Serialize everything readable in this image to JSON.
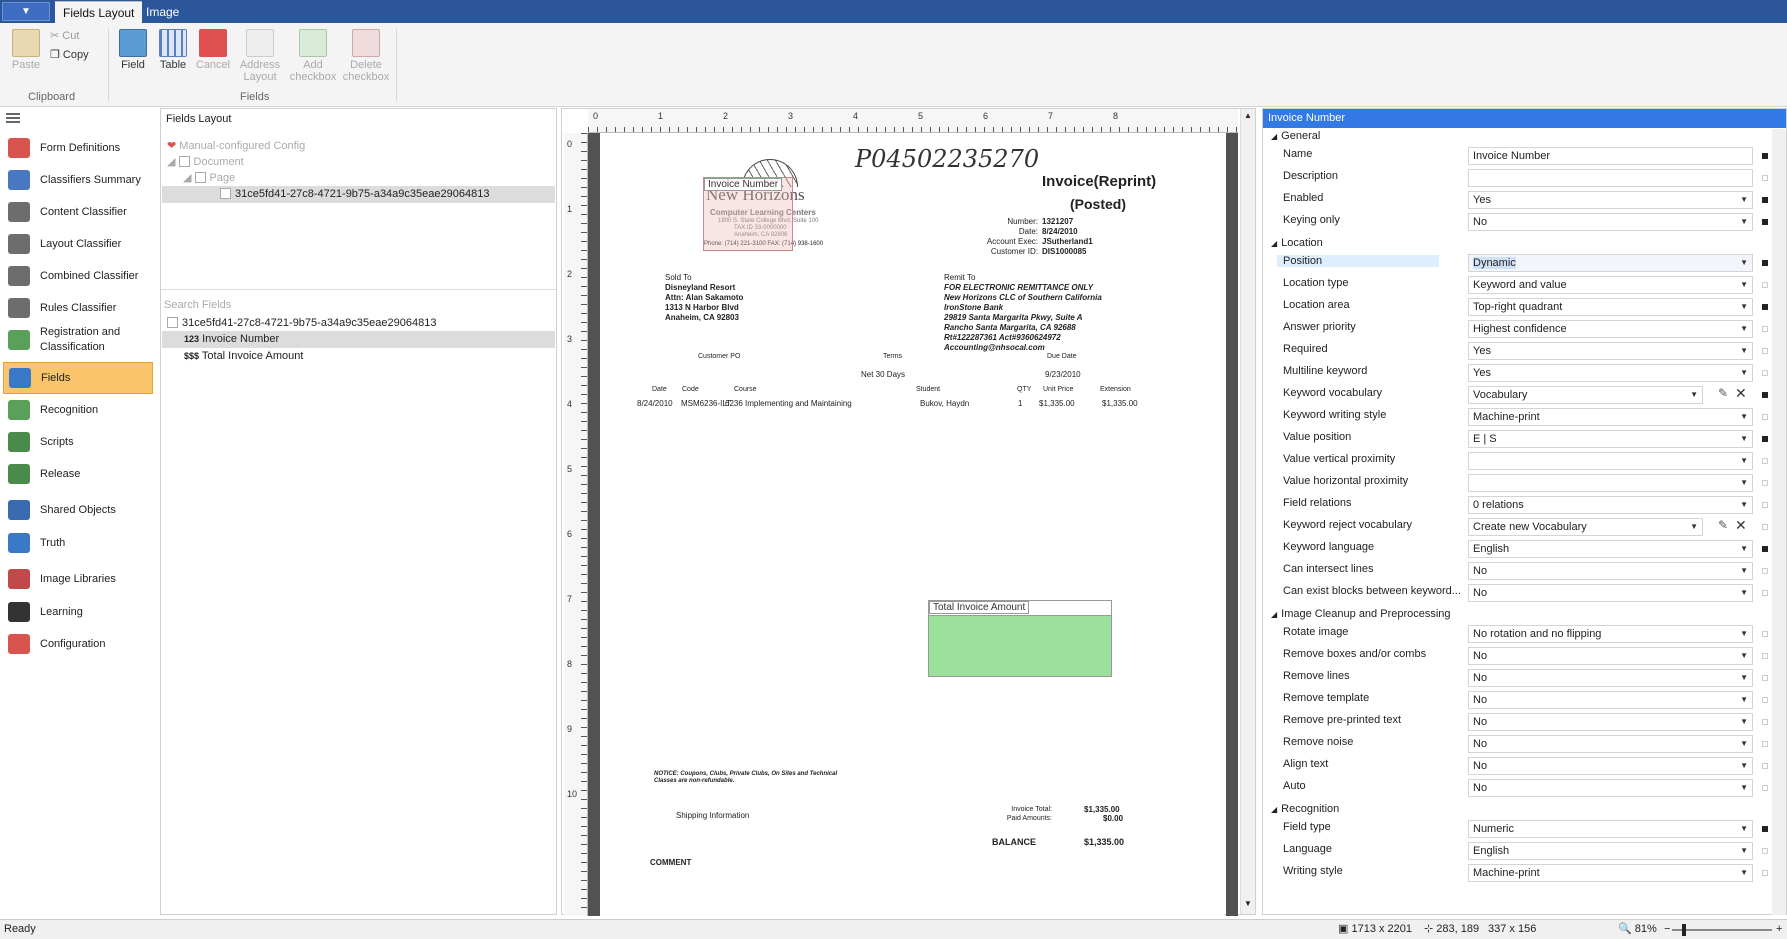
{
  "app": {
    "menu_button": "▼",
    "tabs": [
      "Fields Layout",
      "Image"
    ]
  },
  "ribbon": {
    "clipboard": {
      "paste": "Paste",
      "cut": "Cut",
      "copy": "Copy",
      "group": "Clipboard"
    },
    "fields": {
      "field": "Field",
      "table": "Table",
      "cancel": "Cancel",
      "address_layout": "Address Layout",
      "add_checkbox": "Add checkbox",
      "delete_checkbox": "Delete checkbox",
      "group": "Fields"
    }
  },
  "nav": {
    "items": [
      {
        "label": "Form Definitions",
        "icon": "form-definitions-icon",
        "color": "#d9534f"
      },
      {
        "label": "Classifiers Summary",
        "icon": "classifiers-summary-icon",
        "color": "#4a78c0"
      },
      {
        "label": "Content Classifier",
        "icon": "content-classifier-icon",
        "color": "#6d6d6d"
      },
      {
        "label": "Layout Classifier",
        "icon": "layout-classifier-icon",
        "color": "#6d6d6d"
      },
      {
        "label": "Combined Classifier",
        "icon": "combined-classifier-icon",
        "color": "#6d6d6d"
      },
      {
        "label": "Rules Classifier",
        "icon": "rules-classifier-icon",
        "color": "#6d6d6d"
      },
      {
        "label": "Registration and Classification",
        "icon": "registration-icon",
        "color": "#5aa05a"
      },
      {
        "label": "Fields",
        "icon": "fields-icon",
        "color": "#3a78c8",
        "active": true
      },
      {
        "label": "Recognition",
        "icon": "recognition-icon",
        "color": "#5aa05a"
      },
      {
        "label": "Scripts",
        "icon": "scripts-icon",
        "color": "#4a8a4a"
      },
      {
        "label": "Release",
        "icon": "release-icon",
        "color": "#4a8a4a"
      },
      {
        "label": "Shared Objects",
        "icon": "shared-objects-icon",
        "color": "#3a6ab0"
      },
      {
        "label": "Truth",
        "icon": "truth-icon",
        "color": "#3a78c8"
      },
      {
        "label": "Image Libraries",
        "icon": "image-libraries-icon",
        "color": "#c04a4a"
      },
      {
        "label": "Learning",
        "icon": "learning-icon",
        "color": "#333333"
      },
      {
        "label": "Configuration",
        "icon": "configuration-icon",
        "color": "#d9534f"
      }
    ]
  },
  "fields_panel": {
    "title": "Fields Layout",
    "tree": {
      "config": "Manual-configured Config",
      "document": "Document",
      "page": "Page",
      "guid": "31ce5fd41-27c8-4721-9b75-a34a9c35eae29064813"
    },
    "search_label": "Search Fields",
    "list_guid": "31ce5fd41-27c8-4721-9b75-a34a9c35eae29064813",
    "fields": [
      {
        "prefix": "123",
        "name": "Invoice Number"
      },
      {
        "prefix": "$$$",
        "name": "Total Invoice Amount"
      }
    ]
  },
  "ruler": {
    "h": [
      "0",
      "1",
      "2",
      "3",
      "4",
      "5",
      "6",
      "7",
      "8"
    ],
    "v": [
      "0",
      "1",
      "2",
      "3",
      "4",
      "5",
      "6",
      "7",
      "8",
      "9",
      "10"
    ]
  },
  "document": {
    "handwritten": "P04502235270",
    "title": "Invoice(Reprint)",
    "subtitle": "(Posted)",
    "logo": {
      "name": "New Horizons",
      "tagline": "Computer Learning Centers",
      "addr1": "1900 S. State College Blvd, Suite 100",
      "addr2": "TAX ID 33-0000000",
      "addr3": "Anaheim, CA 92806",
      "phone": "Phone: (714) 221-3100   FAX: (714) 938-1600"
    },
    "meta": [
      [
        "Number:",
        "1321207"
      ],
      [
        "Date:",
        "8/24/2010"
      ],
      [
        "Account Exec:",
        "JSutherland1"
      ],
      [
        "Customer ID:",
        "DIS1000085"
      ]
    ],
    "sold_to": [
      "Sold To",
      "Disneyland Resort",
      "Attn: Alan Sakamoto",
      "1313 N Harbor Blvd",
      "Anaheim, CA  92803"
    ],
    "remit_to": [
      "Remit To",
      "FOR ELECTRONIC REMITTANCE ONLY",
      "New Horizons CLC of Southern California",
      "IronStone Bank",
      "29819 Santa Margarita Pkwy, Suite A",
      "Rancho Santa Margarita, CA 92688",
      "Rt#122287361 Act#9360624972",
      "Accounting@nhsocal.com"
    ],
    "terms_headers": [
      "Customer PO",
      "Terms",
      "Due Date"
    ],
    "terms_values": [
      "",
      "Net 30 Days",
      "9/23/2010"
    ],
    "line_headers": [
      "Date",
      "Code",
      "Course",
      "Student",
      "QTY",
      "Unit Price",
      "Extension"
    ],
    "line_item": [
      "8/24/2010",
      "MSM6236-ILT",
      "6236 Implementing and Maintaining",
      "Bukov, Haydn",
      "1",
      "$1,335.00",
      "$1,335.00"
    ],
    "notice": "NOTICE:  Coupons, Clubs, Private Clubs, On Sites and Technical Classes are non-refundable.",
    "shipping": "Shipping Information",
    "totals": [
      [
        "Invoice Total:",
        "$1,335.00"
      ],
      [
        "Paid Amounts:",
        "$0.00"
      ]
    ],
    "balance_label": "BALANCE",
    "balance_value": "$1,335.00",
    "comment": "COMMENT",
    "zone_invoice": "Invoice Number",
    "zone_total": "Total Invoice Amount",
    "zone_color": "#9be09b"
  },
  "props": {
    "title": "Invoice Number",
    "sections": [
      {
        "name": "General",
        "rows": [
          {
            "label": "Name",
            "value": "Invoice Number",
            "mark": true
          },
          {
            "label": "Description",
            "value": ""
          },
          {
            "label": "Enabled",
            "value": "Yes",
            "dd": true,
            "mark": true
          },
          {
            "label": "Keying only",
            "value": "No",
            "dd": true,
            "mark": true
          }
        ]
      },
      {
        "name": "Location",
        "rows": [
          {
            "label": "Position",
            "value": "Dynamic",
            "dd": true,
            "mark": true,
            "selected": true
          },
          {
            "label": "Location type",
            "value": "Keyword and value",
            "dd": true
          },
          {
            "label": "Location area",
            "value": "Top-right quadrant",
            "dd": true,
            "mark": true
          },
          {
            "label": "Answer priority",
            "value": "Highest confidence",
            "dd": true
          },
          {
            "label": "Required",
            "value": "Yes",
            "dd": true
          },
          {
            "label": "Multiline keyword",
            "value": "Yes",
            "dd": true
          },
          {
            "label": "Keyword vocabulary",
            "value": "Vocabulary",
            "dd": true,
            "tools": true,
            "mark": true
          },
          {
            "label": "Keyword writing style",
            "value": "Machine-print",
            "dd": true
          },
          {
            "label": "Value position",
            "value": "E | S",
            "dd": true,
            "mark": true
          },
          {
            "label": "Value vertical proximity",
            "value": "",
            "dd": true
          },
          {
            "label": "Value horizontal proximity",
            "value": "",
            "dd": true
          },
          {
            "label": "Field relations",
            "value": "0 relations",
            "dd": true
          },
          {
            "label": "Keyword reject vocabulary",
            "value": "Create new Vocabulary",
            "dd": true,
            "tools": true
          },
          {
            "label": "Keyword language",
            "value": "English",
            "dd": true,
            "mark": true
          },
          {
            "label": "Can intersect lines",
            "value": "No",
            "dd": true
          },
          {
            "label": "Can exist blocks between keyword...",
            "value": "No",
            "dd": true
          }
        ]
      },
      {
        "name": "Image Cleanup and Preprocessing",
        "rows": [
          {
            "label": "Rotate image",
            "value": "No rotation and no flipping",
            "dd": true
          },
          {
            "label": "Remove boxes and/or combs",
            "value": "No",
            "dd": true
          },
          {
            "label": "Remove lines",
            "value": "No",
            "dd": true
          },
          {
            "label": "Remove template",
            "value": "No",
            "dd": true
          },
          {
            "label": "Remove pre-printed text",
            "value": "No",
            "dd": true
          },
          {
            "label": "Remove noise",
            "value": "No",
            "dd": true
          },
          {
            "label": "Align text",
            "value": "No",
            "dd": true
          },
          {
            "label": "Auto",
            "value": "No",
            "dd": true
          }
        ]
      },
      {
        "name": "Recognition",
        "rows": [
          {
            "label": "Field type",
            "value": "Numeric",
            "dd": true,
            "mark": true
          },
          {
            "label": "Language",
            "value": "English",
            "dd": true
          },
          {
            "label": "Writing style",
            "value": "Machine-print",
            "dd": true
          }
        ]
      }
    ]
  },
  "status": {
    "ready": "Ready",
    "size": "1713 x 2201",
    "pos": "283, 189",
    "sel": "337 x 156",
    "zoom": "81%"
  }
}
